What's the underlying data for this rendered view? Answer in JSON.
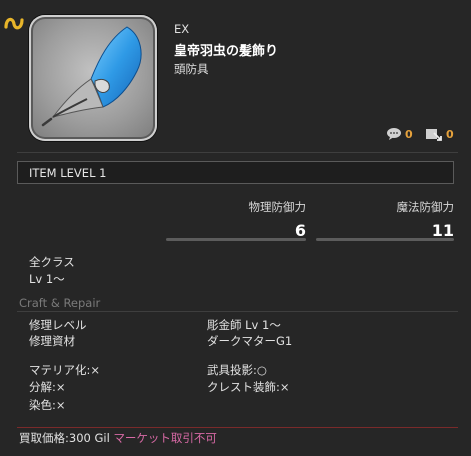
{
  "item": {
    "category_tag": "EX",
    "name": "皇帝羽虫の髪飾り",
    "slot": "頭防具",
    "comment_count": "0",
    "fav_count": "0",
    "item_level": "ITEM LEVEL 1"
  },
  "stats": [
    {
      "label": "物理防御力",
      "value": "6"
    },
    {
      "label": "魔法防御力",
      "value": "11"
    }
  ],
  "equip": {
    "classes": "全クラス",
    "level": "Lv 1～"
  },
  "craft": {
    "header": "Craft & Repair",
    "repair_level_label": "修理レベル",
    "repair_level_value": "彫金師 Lv 1～",
    "repair_mat_label": "修理資材",
    "repair_mat_value": "ダークマターG1",
    "materia": "マテリア化:×",
    "glamour": "武具投影:○",
    "desynth": "分解:×",
    "crest": "クレスト装飾:×",
    "dye": "染色:×"
  },
  "footer": {
    "sell_price": "買取価格:300 Gil",
    "market": "マーケット取引不可"
  },
  "colors": {
    "accent_gold": "#e6a23c",
    "market_pink": "#d96aa6",
    "background": "#262626"
  },
  "icons": [
    "expansion-icon",
    "comment-icon",
    "favorite-icon",
    "item-icon"
  ]
}
